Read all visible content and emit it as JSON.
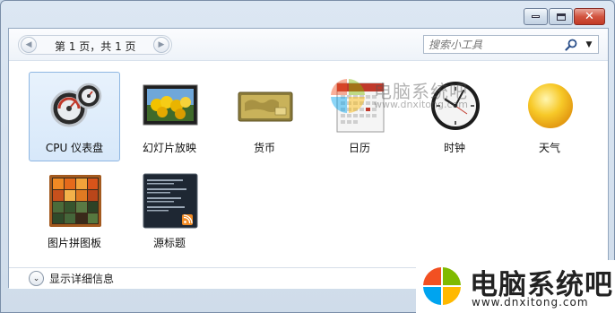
{
  "window": {
    "caption_buttons": [
      "minimize-icon",
      "maximize-icon",
      "close-icon"
    ],
    "close_glyph": "✕"
  },
  "toolbar": {
    "page_text": "第 1 页，共 1 页",
    "prev_icon": "chevron-left-icon",
    "next_icon": "chevron-right-icon",
    "prev_glyph": "◀",
    "next_glyph": "▶",
    "search_placeholder": "搜索小工具",
    "search_icon": "search-icon",
    "dropdown_glyph": "▼"
  },
  "gadgets": [
    {
      "label": "CPU 仪表盘",
      "icon": "cpu-meter-icon",
      "selected": true
    },
    {
      "label": "幻灯片放映",
      "icon": "slideshow-icon",
      "selected": false
    },
    {
      "label": "货币",
      "icon": "currency-card-icon",
      "selected": false
    },
    {
      "label": "日历",
      "icon": "calendar-icon",
      "selected": false
    },
    {
      "label": "时钟",
      "icon": "clock-icon",
      "selected": false
    },
    {
      "label": "天气",
      "icon": "weather-sun-icon",
      "selected": false
    },
    {
      "label": "图片拼图板",
      "icon": "picture-puzzle-icon",
      "selected": false
    },
    {
      "label": "源标题",
      "icon": "feed-headlines-icon",
      "selected": false
    }
  ],
  "footer": {
    "toggle_glyph": "⌄",
    "details_label": "显示详细信息"
  },
  "watermark": {
    "small_title": "电脑系统吧",
    "small_url": "www.dnxitong.com",
    "big_title": "电脑系统吧",
    "big_url": "www.dnxitong.com"
  },
  "colors": {
    "selection": "#d7e8fa",
    "selection_border": "#8fb7e2",
    "close_red": "#c23a25",
    "logo_red": "#f25022",
    "logo_green": "#7fba00",
    "logo_blue": "#00a4ef",
    "logo_yellow": "#ffb900"
  }
}
